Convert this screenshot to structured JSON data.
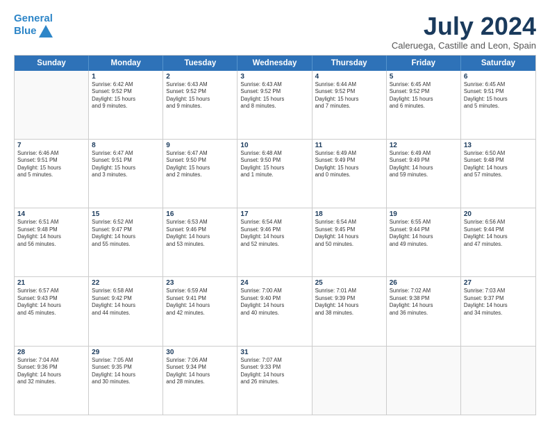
{
  "header": {
    "logo_line1": "General",
    "logo_line2": "Blue",
    "month_title": "July 2024",
    "location": "Caleruega, Castille and Leon, Spain"
  },
  "weekdays": [
    "Sunday",
    "Monday",
    "Tuesday",
    "Wednesday",
    "Thursday",
    "Friday",
    "Saturday"
  ],
  "weeks": [
    [
      {
        "day": "",
        "lines": []
      },
      {
        "day": "1",
        "lines": [
          "Sunrise: 6:42 AM",
          "Sunset: 9:52 PM",
          "Daylight: 15 hours",
          "and 9 minutes."
        ]
      },
      {
        "day": "2",
        "lines": [
          "Sunrise: 6:43 AM",
          "Sunset: 9:52 PM",
          "Daylight: 15 hours",
          "and 9 minutes."
        ]
      },
      {
        "day": "3",
        "lines": [
          "Sunrise: 6:43 AM",
          "Sunset: 9:52 PM",
          "Daylight: 15 hours",
          "and 8 minutes."
        ]
      },
      {
        "day": "4",
        "lines": [
          "Sunrise: 6:44 AM",
          "Sunset: 9:52 PM",
          "Daylight: 15 hours",
          "and 7 minutes."
        ]
      },
      {
        "day": "5",
        "lines": [
          "Sunrise: 6:45 AM",
          "Sunset: 9:52 PM",
          "Daylight: 15 hours",
          "and 6 minutes."
        ]
      },
      {
        "day": "6",
        "lines": [
          "Sunrise: 6:45 AM",
          "Sunset: 9:51 PM",
          "Daylight: 15 hours",
          "and 5 minutes."
        ]
      }
    ],
    [
      {
        "day": "7",
        "lines": [
          "Sunrise: 6:46 AM",
          "Sunset: 9:51 PM",
          "Daylight: 15 hours",
          "and 5 minutes."
        ]
      },
      {
        "day": "8",
        "lines": [
          "Sunrise: 6:47 AM",
          "Sunset: 9:51 PM",
          "Daylight: 15 hours",
          "and 3 minutes."
        ]
      },
      {
        "day": "9",
        "lines": [
          "Sunrise: 6:47 AM",
          "Sunset: 9:50 PM",
          "Daylight: 15 hours",
          "and 2 minutes."
        ]
      },
      {
        "day": "10",
        "lines": [
          "Sunrise: 6:48 AM",
          "Sunset: 9:50 PM",
          "Daylight: 15 hours",
          "and 1 minute."
        ]
      },
      {
        "day": "11",
        "lines": [
          "Sunrise: 6:49 AM",
          "Sunset: 9:49 PM",
          "Daylight: 15 hours",
          "and 0 minutes."
        ]
      },
      {
        "day": "12",
        "lines": [
          "Sunrise: 6:49 AM",
          "Sunset: 9:49 PM",
          "Daylight: 14 hours",
          "and 59 minutes."
        ]
      },
      {
        "day": "13",
        "lines": [
          "Sunrise: 6:50 AM",
          "Sunset: 9:48 PM",
          "Daylight: 14 hours",
          "and 57 minutes."
        ]
      }
    ],
    [
      {
        "day": "14",
        "lines": [
          "Sunrise: 6:51 AM",
          "Sunset: 9:48 PM",
          "Daylight: 14 hours",
          "and 56 minutes."
        ]
      },
      {
        "day": "15",
        "lines": [
          "Sunrise: 6:52 AM",
          "Sunset: 9:47 PM",
          "Daylight: 14 hours",
          "and 55 minutes."
        ]
      },
      {
        "day": "16",
        "lines": [
          "Sunrise: 6:53 AM",
          "Sunset: 9:46 PM",
          "Daylight: 14 hours",
          "and 53 minutes."
        ]
      },
      {
        "day": "17",
        "lines": [
          "Sunrise: 6:54 AM",
          "Sunset: 9:46 PM",
          "Daylight: 14 hours",
          "and 52 minutes."
        ]
      },
      {
        "day": "18",
        "lines": [
          "Sunrise: 6:54 AM",
          "Sunset: 9:45 PM",
          "Daylight: 14 hours",
          "and 50 minutes."
        ]
      },
      {
        "day": "19",
        "lines": [
          "Sunrise: 6:55 AM",
          "Sunset: 9:44 PM",
          "Daylight: 14 hours",
          "and 49 minutes."
        ]
      },
      {
        "day": "20",
        "lines": [
          "Sunrise: 6:56 AM",
          "Sunset: 9:44 PM",
          "Daylight: 14 hours",
          "and 47 minutes."
        ]
      }
    ],
    [
      {
        "day": "21",
        "lines": [
          "Sunrise: 6:57 AM",
          "Sunset: 9:43 PM",
          "Daylight: 14 hours",
          "and 45 minutes."
        ]
      },
      {
        "day": "22",
        "lines": [
          "Sunrise: 6:58 AM",
          "Sunset: 9:42 PM",
          "Daylight: 14 hours",
          "and 44 minutes."
        ]
      },
      {
        "day": "23",
        "lines": [
          "Sunrise: 6:59 AM",
          "Sunset: 9:41 PM",
          "Daylight: 14 hours",
          "and 42 minutes."
        ]
      },
      {
        "day": "24",
        "lines": [
          "Sunrise: 7:00 AM",
          "Sunset: 9:40 PM",
          "Daylight: 14 hours",
          "and 40 minutes."
        ]
      },
      {
        "day": "25",
        "lines": [
          "Sunrise: 7:01 AM",
          "Sunset: 9:39 PM",
          "Daylight: 14 hours",
          "and 38 minutes."
        ]
      },
      {
        "day": "26",
        "lines": [
          "Sunrise: 7:02 AM",
          "Sunset: 9:38 PM",
          "Daylight: 14 hours",
          "and 36 minutes."
        ]
      },
      {
        "day": "27",
        "lines": [
          "Sunrise: 7:03 AM",
          "Sunset: 9:37 PM",
          "Daylight: 14 hours",
          "and 34 minutes."
        ]
      }
    ],
    [
      {
        "day": "28",
        "lines": [
          "Sunrise: 7:04 AM",
          "Sunset: 9:36 PM",
          "Daylight: 14 hours",
          "and 32 minutes."
        ]
      },
      {
        "day": "29",
        "lines": [
          "Sunrise: 7:05 AM",
          "Sunset: 9:35 PM",
          "Daylight: 14 hours",
          "and 30 minutes."
        ]
      },
      {
        "day": "30",
        "lines": [
          "Sunrise: 7:06 AM",
          "Sunset: 9:34 PM",
          "Daylight: 14 hours",
          "and 28 minutes."
        ]
      },
      {
        "day": "31",
        "lines": [
          "Sunrise: 7:07 AM",
          "Sunset: 9:33 PM",
          "Daylight: 14 hours",
          "and 26 minutes."
        ]
      },
      {
        "day": "",
        "lines": []
      },
      {
        "day": "",
        "lines": []
      },
      {
        "day": "",
        "lines": []
      }
    ]
  ]
}
